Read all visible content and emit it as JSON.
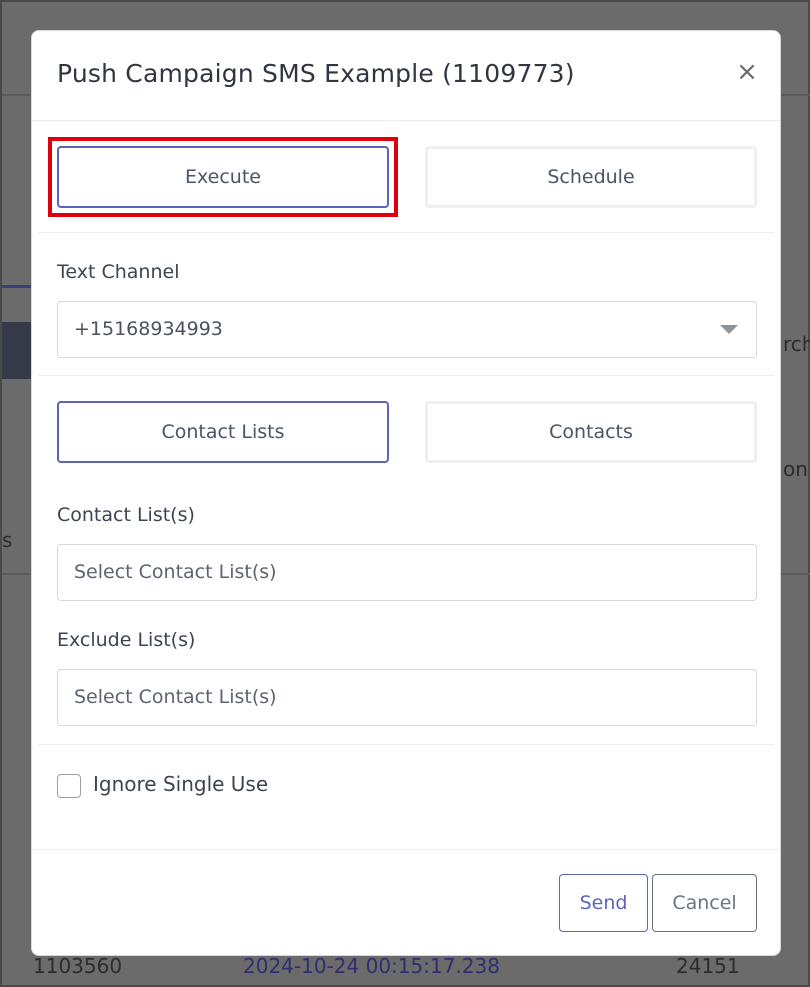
{
  "modal": {
    "title": "Push Campaign SMS Example (1109773)",
    "close_symbol": "×",
    "mode_tabs": [
      {
        "label": "Execute",
        "active": true
      },
      {
        "label": "Schedule",
        "active": false
      }
    ],
    "text_channel": {
      "label": "Text Channel",
      "selected": "+15168934993"
    },
    "target_tabs": [
      {
        "label": "Contact Lists",
        "active": true
      },
      {
        "label": "Contacts",
        "active": false
      }
    ],
    "contact_lists": {
      "label": "Contact List(s)",
      "placeholder": "Select Contact List(s)"
    },
    "exclude_lists": {
      "label": "Exclude List(s)",
      "placeholder": "Select Contact List(s)"
    },
    "ignore_single_use": {
      "label": "Ignore Single Use",
      "checked": false
    },
    "footer": {
      "send_label": "Send",
      "cancel_label": "Cancel"
    }
  },
  "background": {
    "fragment_rch": "rch",
    "fragment_on": "on",
    "fragment_s": "s",
    "row_id": "1103560",
    "row_timestamp": "2024-10-24 00:15:17.238",
    "row_count": "24151"
  },
  "colors": {
    "accent": "#5c63bd",
    "highlight": "#e0000d",
    "overlay": "#6b6b6b"
  }
}
